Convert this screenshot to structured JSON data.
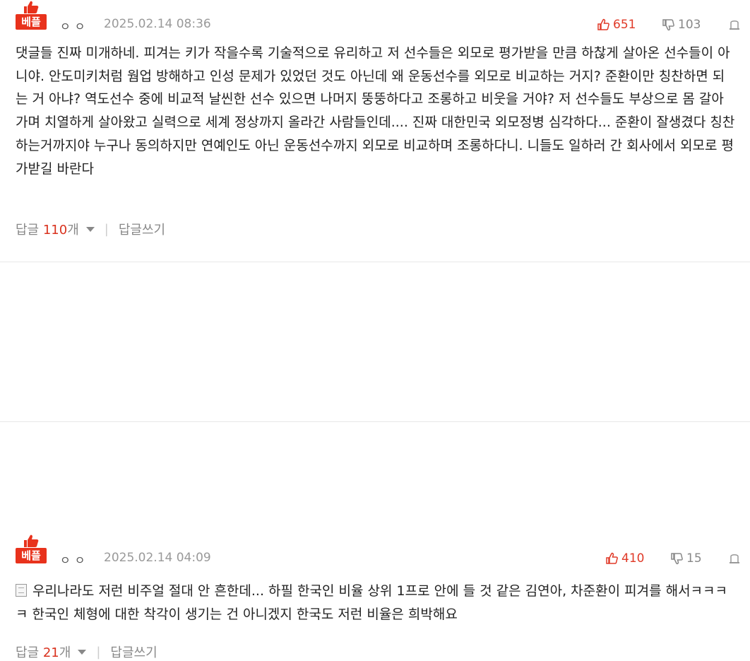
{
  "comments": [
    {
      "badge": "베플",
      "user_masked": "ㅇㅇ",
      "timestamp": "2025.02.14 08:36",
      "likes": "651",
      "dislikes": "103",
      "text": "댓글들 진짜 미개하네. 피겨는 키가 작을수록 기술적으로 유리하고 저 선수들은 외모로 평가받을 만큼 하찮게 살아온 선수들이 아니야. 안도미키처럼 웜업 방해하고 인성 문제가 있었던 것도 아닌데 왜 운동선수를 외모로 비교하는 거지? 준환이만 칭찬하면 되는 거 아냐? 역도선수 중에 비교적 날씬한 선수 있으면 나머지 뚱뚱하다고 조롱하고 비웃을 거야? 저 선수들도 부상으로 몸 갈아가며 치열하게 살아왔고 실력으로 세계 정상까지 올라간 사람들인데.... 진짜 대한민국 외모정병 심각하다... 준환이 잘생겼다 칭찬하는거까지야 누구나 동의하지만 연예인도 아닌 운동선수까지 외모로 비교하며 조롱하다니. 니들도 일하러 간 회사에서 외모로 평가받길 바란다",
      "reply_label": "답글",
      "reply_count": "110",
      "reply_unit": "개",
      "write_reply": "답글쓰기"
    },
    {
      "badge": "베플",
      "user_masked": "ㅇㅇ",
      "timestamp": "2025.02.14 04:09",
      "likes": "410",
      "dislikes": "15",
      "text": "우리나라도 저런 비주얼 절대 안 흔한데... 하필 한국인 비율 상위 1프로 안에 들 것 같은 김연아, 차준환이 피겨를 해서ㅋㅋㅋㅋ 한국인 체형에 대한 착각이 생기는 건 아니겠지 한국도 저런 비율은 희박해요",
      "reply_label": "답글",
      "reply_count": "21",
      "reply_unit": "개",
      "write_reply": "답글쓰기"
    }
  ],
  "colors": {
    "accent": "#e8321c",
    "muted": "#888888"
  },
  "icons": {
    "best": "thumbs-up-icon",
    "like": "thumbs-up-icon",
    "dislike": "thumbs-down-icon",
    "report": "report-icon",
    "attachment": "document-icon"
  }
}
